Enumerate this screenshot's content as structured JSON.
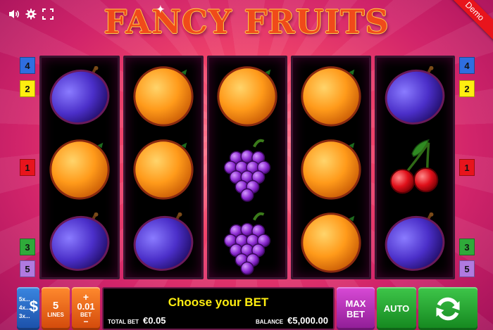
{
  "game": {
    "title": "FANCY FRUITS",
    "mode_badge": "Demo"
  },
  "icons": [
    "speaker-icon",
    "gear-icon",
    "fullscreen-icon",
    "dollar-icon",
    "spin-arrows-icon"
  ],
  "paylines": {
    "left": [
      "4",
      "2",
      "1",
      "3",
      "5"
    ],
    "right": [
      "4",
      "2",
      "1",
      "3",
      "5"
    ],
    "colors": {
      "1": "#e8141c",
      "2": "#ffee10",
      "3": "#2faa3a",
      "4": "#2f6ee0",
      "5": "#b07ae0"
    }
  },
  "reels": [
    [
      "plum",
      "orange",
      "plum"
    ],
    [
      "orange",
      "orange",
      "plum"
    ],
    [
      "orange",
      "grapes",
      "grapes"
    ],
    [
      "orange",
      "orange",
      "orange"
    ],
    [
      "plum",
      "cherries",
      "plum"
    ]
  ],
  "controls": {
    "paytable": {
      "multipliers": [
        "5x...",
        "4x...",
        "3x..."
      ],
      "symbol": "$"
    },
    "lines": {
      "value": "5",
      "label": "LINES"
    },
    "bet": {
      "plus": "+",
      "value": "0.01",
      "label": "BET",
      "minus": "−"
    },
    "message": "Choose your BET",
    "total_bet": {
      "label": "TOTAL BET",
      "value": "€0.05"
    },
    "balance": {
      "label": "BALANCE",
      "value": "€5,000.00"
    },
    "max_bet": {
      "line1": "MAX",
      "line2": "BET"
    },
    "auto": "AUTO"
  }
}
